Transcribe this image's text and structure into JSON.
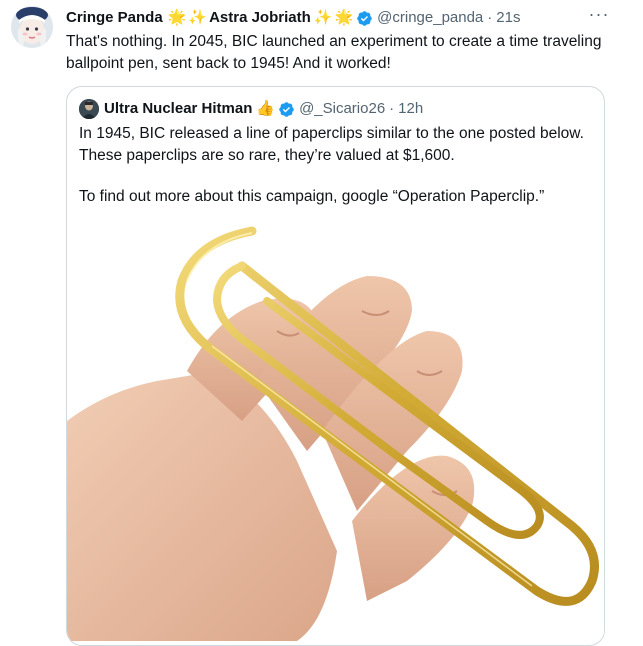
{
  "tweet": {
    "author_name": "Cringe Panda",
    "author_emoji_1": "🌟",
    "author_emoji_2": "✨",
    "author_name_2": "Astra Jobriath",
    "author_emoji_3": "✨",
    "author_emoji_4": "🌟",
    "handle": "@cringe_panda",
    "separator": "·",
    "time": "21s",
    "more_label": "···",
    "text": "That's nothing. In 2045, BIC launched an experiment to create a time traveling ballpoint pen, sent back to 1945! And it worked!"
  },
  "quote": {
    "author_name": "Ultra Nuclear Hitman",
    "author_emoji": "👍",
    "handle": "@_Sicario26",
    "separator": "·",
    "time": "12h",
    "paragraph_1": "In 1945, BIC released a line of paperclips similar to the one posted below. These paperclips are so rare, they’re valued at $1,600.",
    "paragraph_2": "To find out more about this campaign, google “Operation Paperclip.”"
  },
  "colors": {
    "text": "#0f1419",
    "secondary": "#536471",
    "verified": "#1d9bf0",
    "border": "#cfd9de",
    "paperclip": "#d8b43c"
  },
  "icons": {
    "verified": "verified-badge-icon",
    "more": "more-options-icon"
  }
}
